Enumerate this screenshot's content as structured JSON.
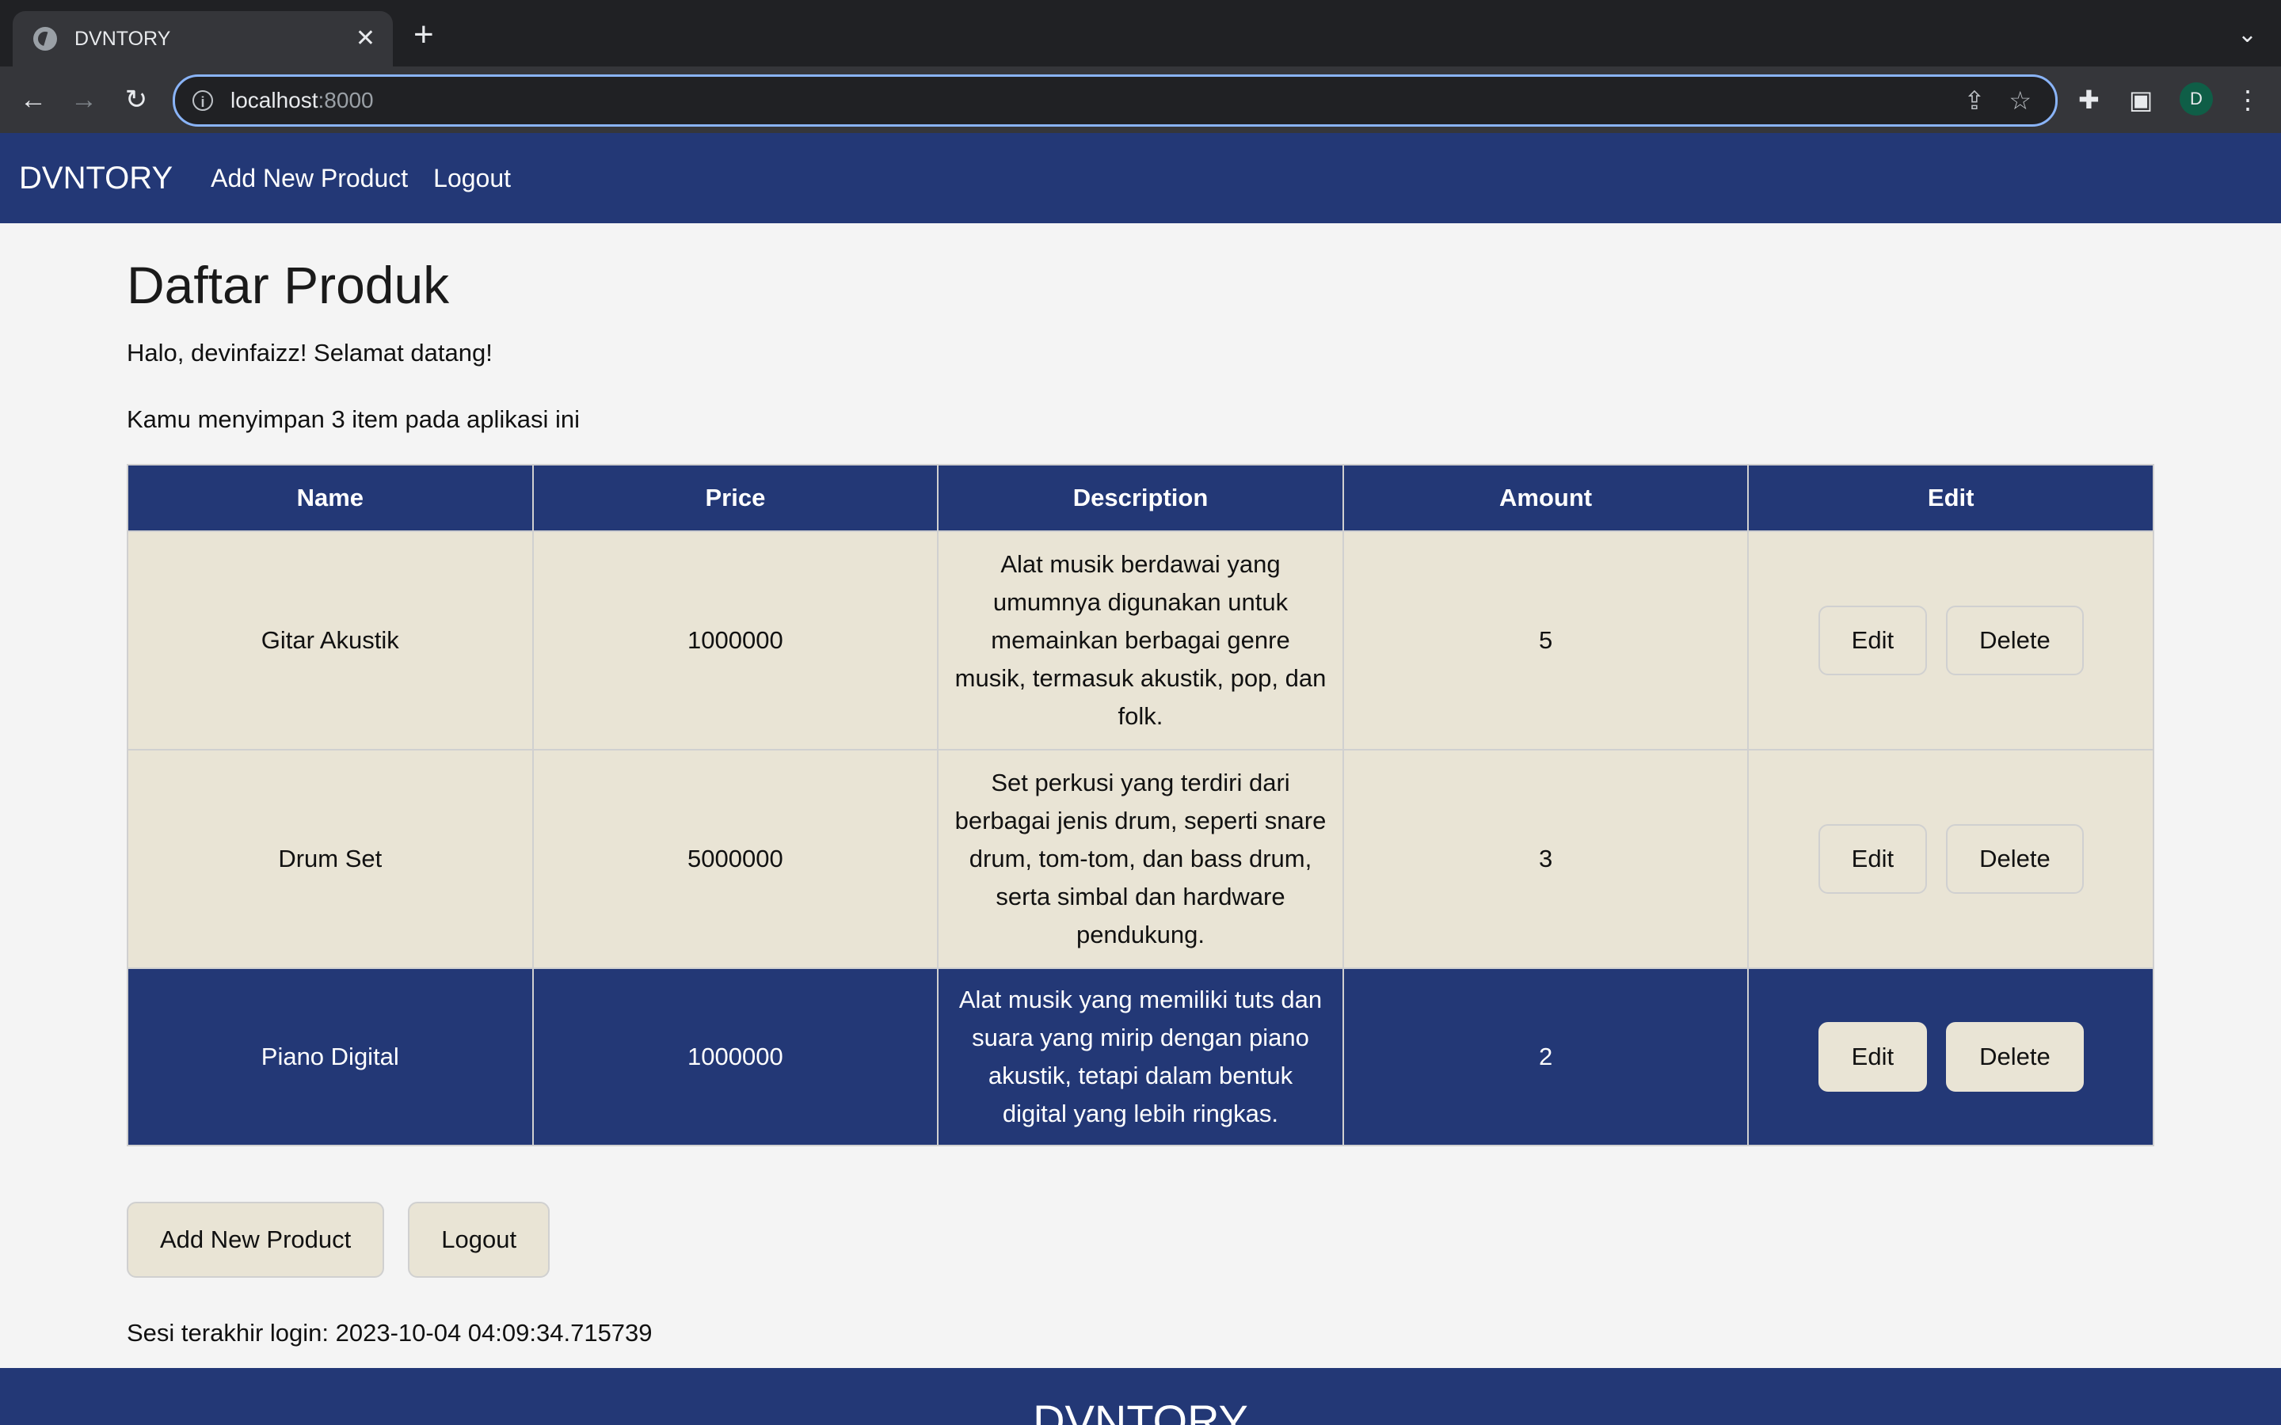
{
  "browser": {
    "tab_title": "DVNTORY",
    "url_host": "localhost",
    "url_port": ":8000",
    "profile_initial": "D"
  },
  "navbar": {
    "brand": "DVNTORY",
    "links": [
      "Add New Product",
      "Logout"
    ]
  },
  "main": {
    "title": "Daftar Produk",
    "greeting": "Halo, devinfaizz! Selamat datang!",
    "item_count_text": "Kamu menyimpan 3 item pada aplikasi ini",
    "table": {
      "headers": [
        "Name",
        "Price",
        "Description",
        "Amount",
        "Edit"
      ],
      "rows": [
        {
          "name": "Gitar Akustik",
          "price": "1000000",
          "description": "Alat musik berdawai yang umumnya digunakan untuk memainkan berbagai genre musik, termasuk akustik, pop, dan folk.",
          "amount": "5"
        },
        {
          "name": "Drum Set",
          "price": "5000000",
          "description": "Set perkusi yang terdiri dari berbagai jenis drum, seperti snare drum, tom-tom, dan bass drum, serta simbal dan hardware pendukung.",
          "amount": "3"
        },
        {
          "name": "Piano Digital",
          "price": "1000000",
          "description": "Alat musik yang memiliki tuts dan suara yang mirip dengan piano akustik, tetapi dalam bentuk digital yang lebih ringkas.",
          "amount": "2"
        }
      ],
      "edit_label": "Edit",
      "delete_label": "Delete"
    },
    "add_button": "Add New Product",
    "logout_button": "Logout",
    "session_text": "Sesi terakhir login: 2023-10-04 04:09:34.715739"
  },
  "footer": {
    "brand": "DVNTORY"
  },
  "colors": {
    "navy": "#233876",
    "beige": "#e9e4d5"
  }
}
